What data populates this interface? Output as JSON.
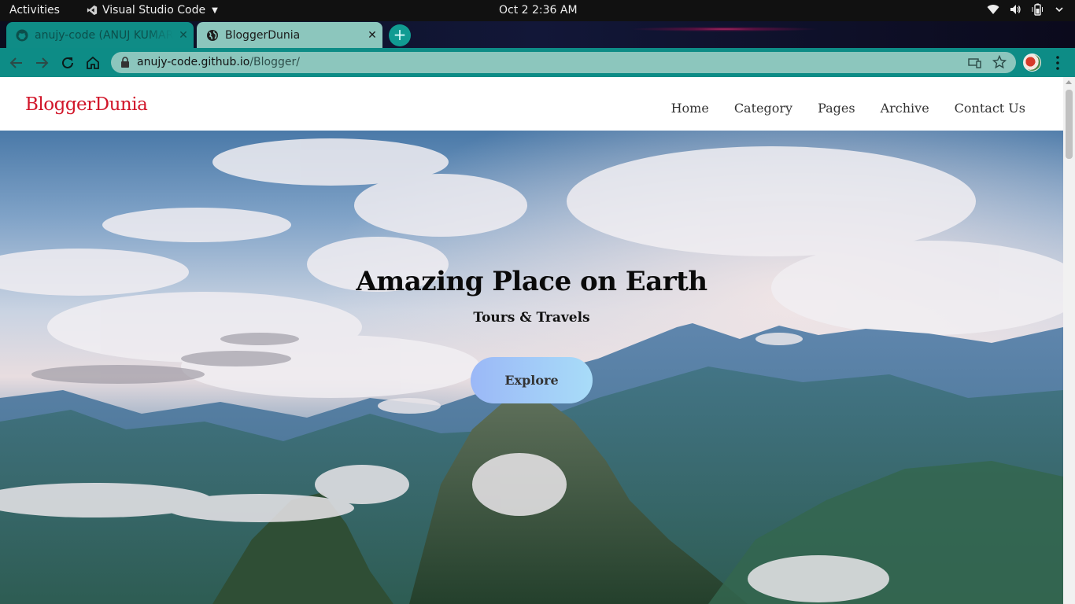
{
  "system_bar": {
    "activities": "Activities",
    "app_name": "Visual Studio Code",
    "clock": "Oct 2   2:36 AM",
    "tray_icons": [
      "wifi-icon",
      "volume-icon",
      "battery-icon",
      "power-menu-icon"
    ]
  },
  "browser": {
    "tabs": [
      {
        "title": "anujy-code (ANUJ KUMAR",
        "favicon": "github-icon",
        "active": false
      },
      {
        "title": "BloggerDunia",
        "favicon": "globe-icon",
        "active": true
      }
    ],
    "new_tab": "+",
    "url_host": "anujy-code.github.io",
    "url_path": "/Blogger/",
    "colors": {
      "theme": "#0d8c86",
      "tab_active": "#8cc6bd"
    }
  },
  "site": {
    "brand": "BloggerDunia",
    "brand_color": "#d11529",
    "nav": [
      "Home",
      "Category",
      "Pages",
      "Archive",
      "Contact Us"
    ],
    "hero": {
      "title": "Amazing Place on Earth",
      "subtitle": "Tours & Travels",
      "button": "Explore"
    }
  }
}
